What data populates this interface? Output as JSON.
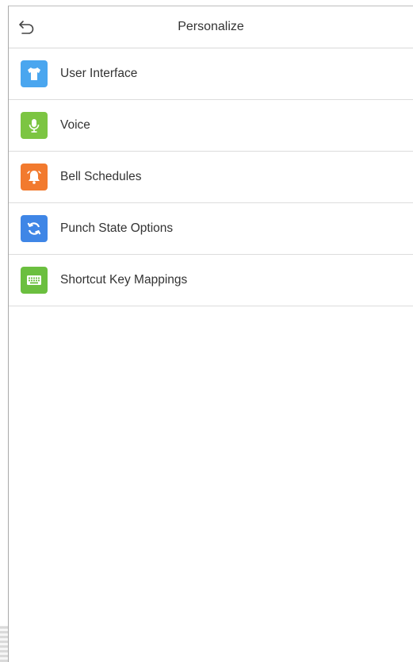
{
  "header": {
    "title": "Personalize",
    "back_icon": "back-arrow-icon"
  },
  "menu": {
    "items": [
      {
        "label": "User Interface",
        "icon": "tshirt-icon",
        "color": "#4aa6ef"
      },
      {
        "label": "Voice",
        "icon": "microphone-icon",
        "color": "#7cc542"
      },
      {
        "label": "Bell Schedules",
        "icon": "bell-icon",
        "color": "#f27a2e"
      },
      {
        "label": "Punch State Options",
        "icon": "sync-icon",
        "color": "#3f86e6"
      },
      {
        "label": "Shortcut Key Mappings",
        "icon": "keyboard-icon",
        "color": "#6bbf3f"
      }
    ]
  }
}
